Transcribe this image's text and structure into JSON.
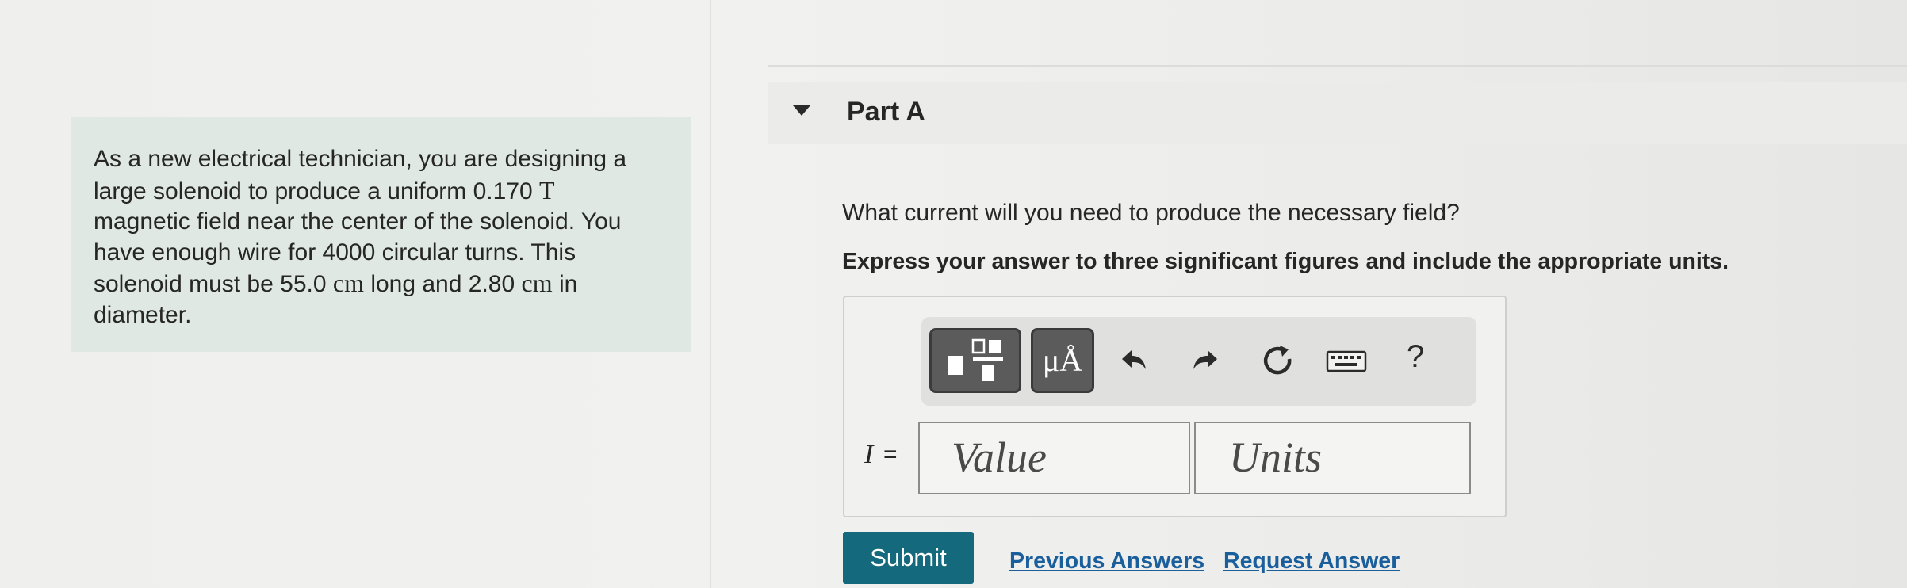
{
  "problem": {
    "line1": "As a new electrical technician, you are designing a",
    "line2_pre": "large solenoid to produce a uniform 0.170",
    "line2_unit": "T",
    "line3": "magnetic field near the center of the solenoid. You",
    "line4": "have enough wire for 4000 circular turns. This",
    "line5_pre": "solenoid must be 55.0",
    "line5_unit1": "cm",
    "line5_mid": "long and 2.80",
    "line5_unit2": "cm",
    "line5_post": "in",
    "line6": "diameter."
  },
  "part": {
    "title": "Part A",
    "question": "What current will you need to produce the necessary field?",
    "instruction": "Express your answer to three significant figures and include the appropriate units."
  },
  "toolbar": {
    "units_label": "μÅ",
    "help_label": "?"
  },
  "answer": {
    "variable": "I",
    "equals": "=",
    "value_placeholder": "Value",
    "units_placeholder": "Units"
  },
  "actions": {
    "submit": "Submit",
    "previous_answers": "Previous Answers",
    "request_answer": "Request Answer"
  }
}
